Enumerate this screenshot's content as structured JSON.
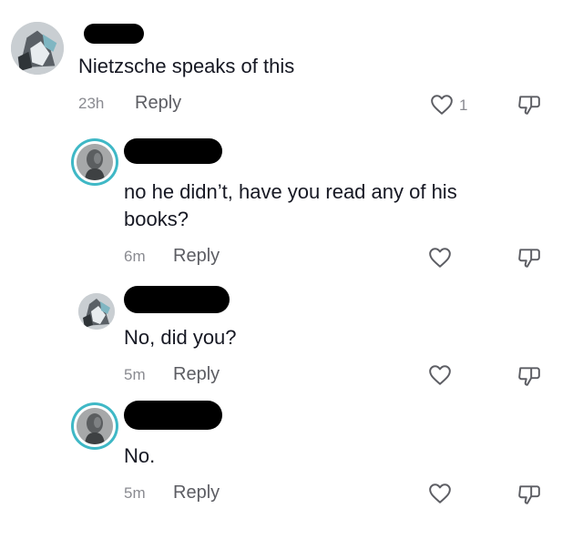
{
  "comments": [
    {
      "text": "Nietzsche speaks of this",
      "time": "23h",
      "reply_label": "Reply",
      "likes": "1",
      "avatar_icon": "statue-collage-avatar"
    },
    {
      "text": "no he didn’t, have you read any of his books?",
      "time": "6m",
      "reply_label": "Reply",
      "avatar_icon": "bust-portrait-avatar"
    },
    {
      "text": "No, did you?",
      "time": "5m",
      "reply_label": "Reply",
      "avatar_icon": "statue-collage-avatar"
    },
    {
      "text": "No.",
      "time": "5m",
      "reply_label": "Reply",
      "avatar_icon": "bust-portrait-avatar"
    }
  ],
  "icons": {
    "like": "heart-outline-icon",
    "dislike": "thumbs-down-outline-icon"
  },
  "colors": {
    "text": "#161823",
    "meta": "#8a8b91",
    "reply": "#5c5d63",
    "avatar_ring": "#3fb8c6",
    "redaction": "#000000"
  }
}
